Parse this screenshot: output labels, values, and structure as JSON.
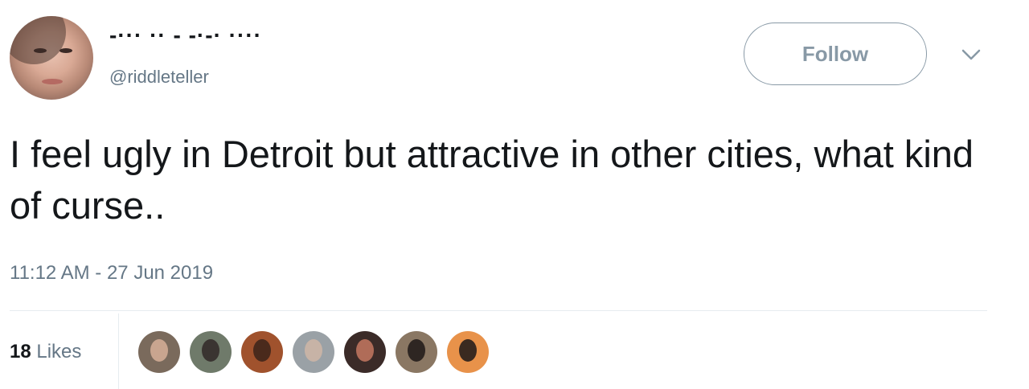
{
  "author": {
    "display_name": "-··· ·· - -·-· ····",
    "handle": "@riddleteller",
    "avatar_icon": "profile-photo"
  },
  "follow_button": {
    "label": "Follow"
  },
  "menu": {
    "icon": "chevron-down-icon"
  },
  "tweet": {
    "text": "I feel ugly in Detroit but attractive in other cities, what kind of curse..",
    "timestamp": "11:12 AM - 27 Jun 2019"
  },
  "stats": {
    "likes_count": "18",
    "likes_label": "Likes"
  },
  "likers": [
    {
      "name": "liker-avatar-1",
      "bg": "#7a6a5c",
      "face": "#c9a58f"
    },
    {
      "name": "liker-avatar-2",
      "bg": "#6f7a6a",
      "face": "#3a3431"
    },
    {
      "name": "liker-avatar-3",
      "bg": "#a0522d",
      "face": "#4a2a1c"
    },
    {
      "name": "liker-avatar-4",
      "bg": "#9aa1a6",
      "face": "#c7b3a6"
    },
    {
      "name": "liker-avatar-5",
      "bg": "#3b2b28",
      "face": "#b06c58"
    },
    {
      "name": "liker-avatar-6",
      "bg": "#8a7763",
      "face": "#2e2622"
    },
    {
      "name": "liker-avatar-7",
      "bg": "#e8924a",
      "face": "#3a2a20"
    }
  ],
  "colors": {
    "text_primary": "#14171a",
    "text_secondary": "#657786",
    "button_border": "#8899a6",
    "divider": "#e6ecf0"
  }
}
